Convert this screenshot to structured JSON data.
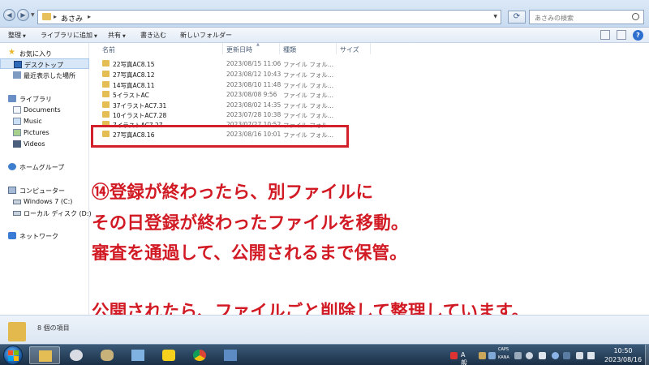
{
  "address": {
    "path": "あさみ",
    "search_placeholder": "あさみの検索"
  },
  "toolbar": {
    "organize": "整理",
    "add_to_library": "ライブラリに追加",
    "share": "共有",
    "burn": "書き込む",
    "new_folder": "新しいフォルダー"
  },
  "nav": {
    "favorites": "お気に入り",
    "desktop": "デスクトップ",
    "recent": "最近表示した場所",
    "libraries": "ライブラリ",
    "documents": "Documents",
    "music": "Music",
    "pictures": "Pictures",
    "videos": "Videos",
    "homegroup": "ホームグループ",
    "computer": "コンピューター",
    "drive_c": "Windows 7 (C:)",
    "drive_d": "ローカル ディスク (D:)",
    "network": "ネットワーク"
  },
  "columns": {
    "name": "名前",
    "date": "更新日時",
    "type": "種類",
    "size": "サイズ"
  },
  "files": [
    {
      "name": "22写真AC8.15",
      "date": "2023/08/15 11:06",
      "type": "ファイル フォル..."
    },
    {
      "name": "27写真AC8.12",
      "date": "2023/08/12 10:43",
      "type": "ファイル フォル..."
    },
    {
      "name": "14写真AC8.11",
      "date": "2023/08/10 11:48",
      "type": "ファイル フォル..."
    },
    {
      "name": "5イラストAC",
      "date": "2023/08/08 9:56",
      "type": "ファイル フォル..."
    },
    {
      "name": "37イラストAC7.31",
      "date": "2023/08/02 14:35",
      "type": "ファイル フォル..."
    },
    {
      "name": "10イラストAC7.28",
      "date": "2023/07/28 10:38",
      "type": "ファイル フォル..."
    },
    {
      "name": "7イラストAC7.27",
      "date": "2023/07/27 10:52",
      "type": "ファイル フォル..."
    },
    {
      "name": "27写真AC8.16",
      "date": "2023/08/16 10:01",
      "type": "ファイル フォル..."
    }
  ],
  "annotation": {
    "line1": "⑭登録が終わったら、別ファイルに",
    "line2": "その日登録が終わったファイルを移動。",
    "line3": "審査を通過して、公開されるまで保管。",
    "line4": "公開されたら、ファイルごと削除して整理しています。",
    "color": "#d11a24"
  },
  "details": {
    "count": "8 個の項目"
  },
  "taskbar": {
    "tray_ime": "A 般",
    "caps": "CAPS",
    "kana": "KANA",
    "time": "10:50",
    "date": "2023/08/16"
  }
}
